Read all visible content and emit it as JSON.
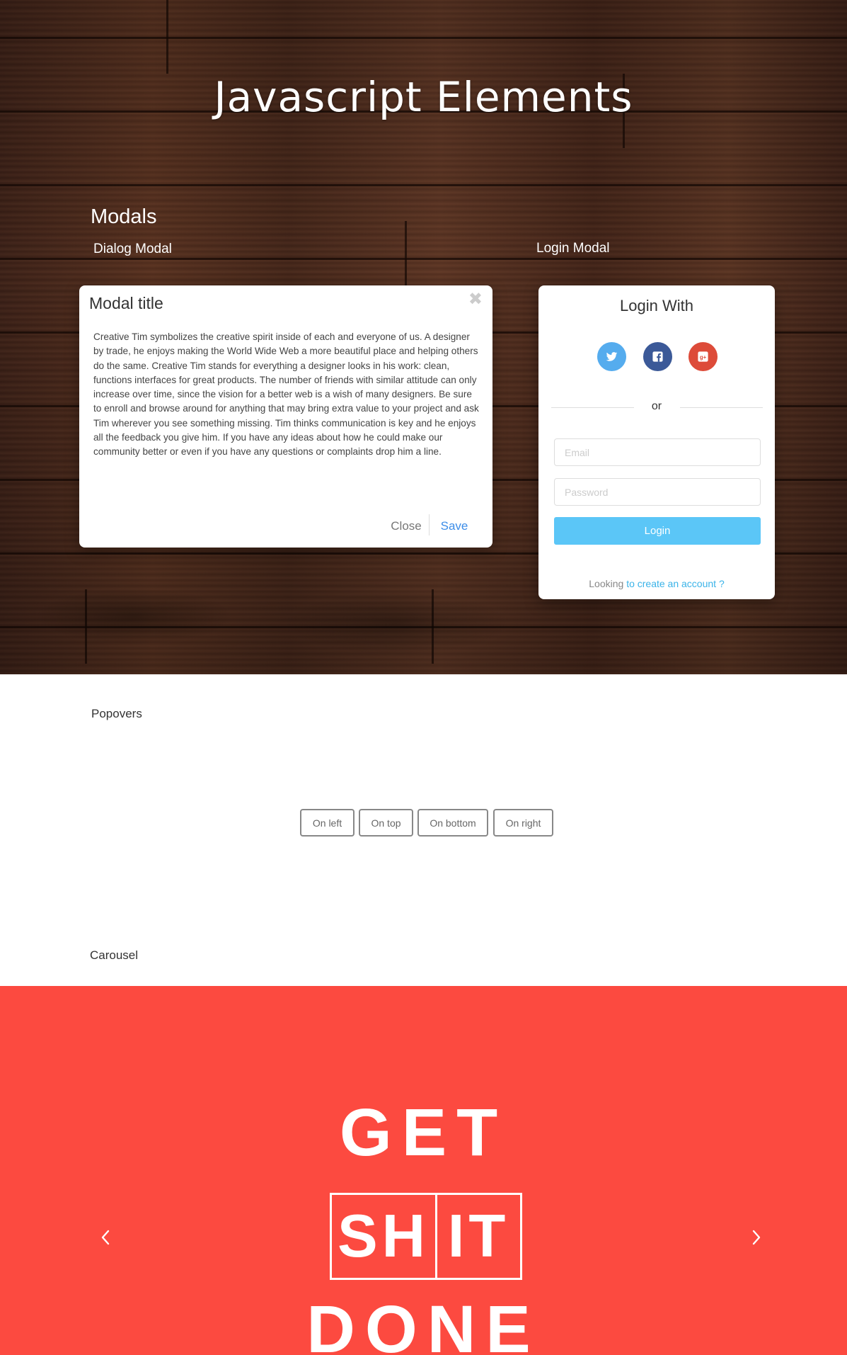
{
  "hero": {
    "title": "Javascript Elements"
  },
  "modals": {
    "heading": "Modals",
    "dialog_label": "Dialog Modal",
    "login_label": "Login Modal",
    "dialog": {
      "title": "Modal title",
      "close_icon": "close-icon",
      "body": "Creative Tim symbolizes the creative spirit inside of each and everyone of us. A designer by trade, he enjoys making the World Wide Web a more beautiful place and helping others do the same. Creative Tim stands for everything a designer looks in his work: clean, functions interfaces for great products. The number of friends with similar attitude can only increase over time, since the vision for a better web is a wish of many designers. Be sure to enroll and browse around for anything that may bring extra value to your project and ask Tim wherever you see something missing. Tim thinks communication is key and he enjoys all the feedback you give him. If you have any ideas about how he could make our community better or even if you have any questions or complaints drop him a line.",
      "close_label": "Close",
      "save_label": "Save"
    },
    "login": {
      "title": "Login With",
      "socials": [
        {
          "name": "twitter-icon",
          "color": "#55acee"
        },
        {
          "name": "facebook-icon",
          "color": "#3b5998"
        },
        {
          "name": "google-plus-icon",
          "color": "#dd4b39"
        }
      ],
      "or_text": "or",
      "email_placeholder": "Email",
      "password_placeholder": "Password",
      "button_label": "Login",
      "footer_prefix": "Looking",
      "footer_link": "to create an account ?"
    }
  },
  "popovers": {
    "heading": "Popovers",
    "buttons": [
      "On left",
      "On top",
      "On bottom",
      "On right"
    ]
  },
  "carousel": {
    "heading": "Carousel",
    "background_color": "#fc4a40",
    "prev_icon": "chevron-left-icon",
    "next_icon": "chevron-right-icon",
    "slide_text": {
      "line1": "GET",
      "box_left": "SH",
      "box_right": "IT",
      "line3": "DONE"
    }
  },
  "colors": {
    "accent_blue": "#3c8de8",
    "login_button": "#5bc6f7",
    "link": "#3ab3e8"
  }
}
